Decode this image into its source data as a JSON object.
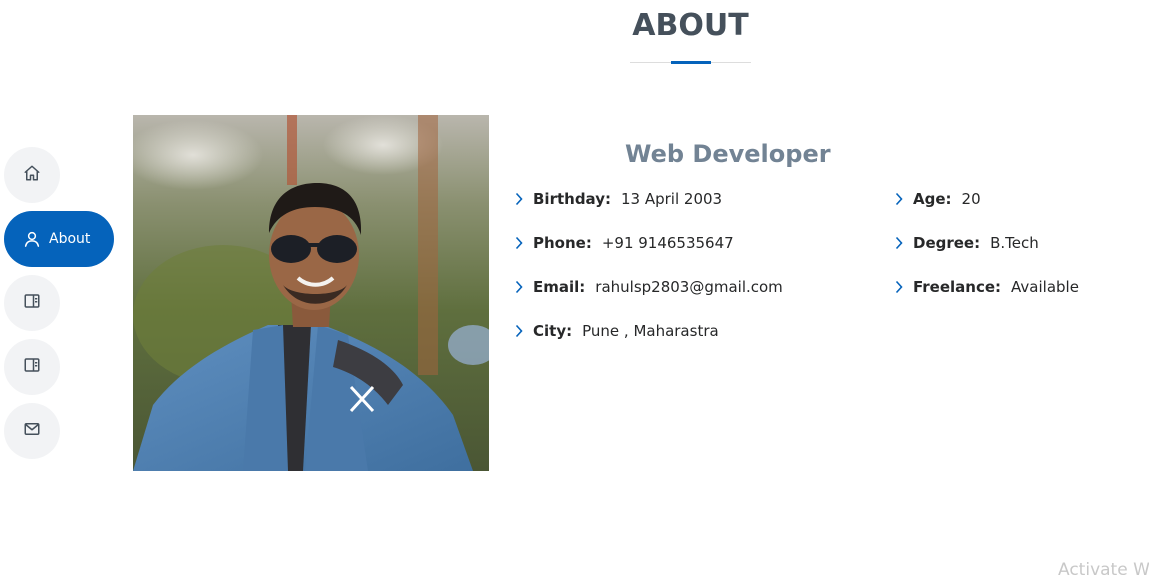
{
  "section": {
    "title": "ABOUT"
  },
  "nav": {
    "items": [
      {
        "name": "home",
        "icon": "home-icon",
        "label": ""
      },
      {
        "name": "about",
        "icon": "person-icon",
        "label": "About"
      },
      {
        "name": "resume",
        "icon": "book-icon",
        "label": ""
      },
      {
        "name": "portfolio",
        "icon": "book-icon",
        "label": ""
      },
      {
        "name": "contact",
        "icon": "envelope-icon",
        "label": ""
      }
    ],
    "active": "about"
  },
  "profile": {
    "photo_alt": "Profile photo",
    "role": "Web Developer"
  },
  "details": {
    "birthday": {
      "label": "Birthday:",
      "value": "13 April 2003"
    },
    "phone": {
      "label": "Phone:",
      "value": "+91 9146535647"
    },
    "email": {
      "label": "Email:",
      "value": "rahulsp2803@gmail.com"
    },
    "city": {
      "label": "City:",
      "value": "Pune , Maharastra"
    },
    "age": {
      "label": "Age:",
      "value": "20"
    },
    "degree": {
      "label": "Degree:",
      "value": "B.Tech"
    },
    "freelance": {
      "label": "Freelance:",
      "value": "Available"
    }
  },
  "os": {
    "watermark": "Activate W"
  },
  "colors": {
    "accent": "#0563bb",
    "heading": "#45505b",
    "subheading": "#728394",
    "nav_bg": "#f2f3f5"
  }
}
